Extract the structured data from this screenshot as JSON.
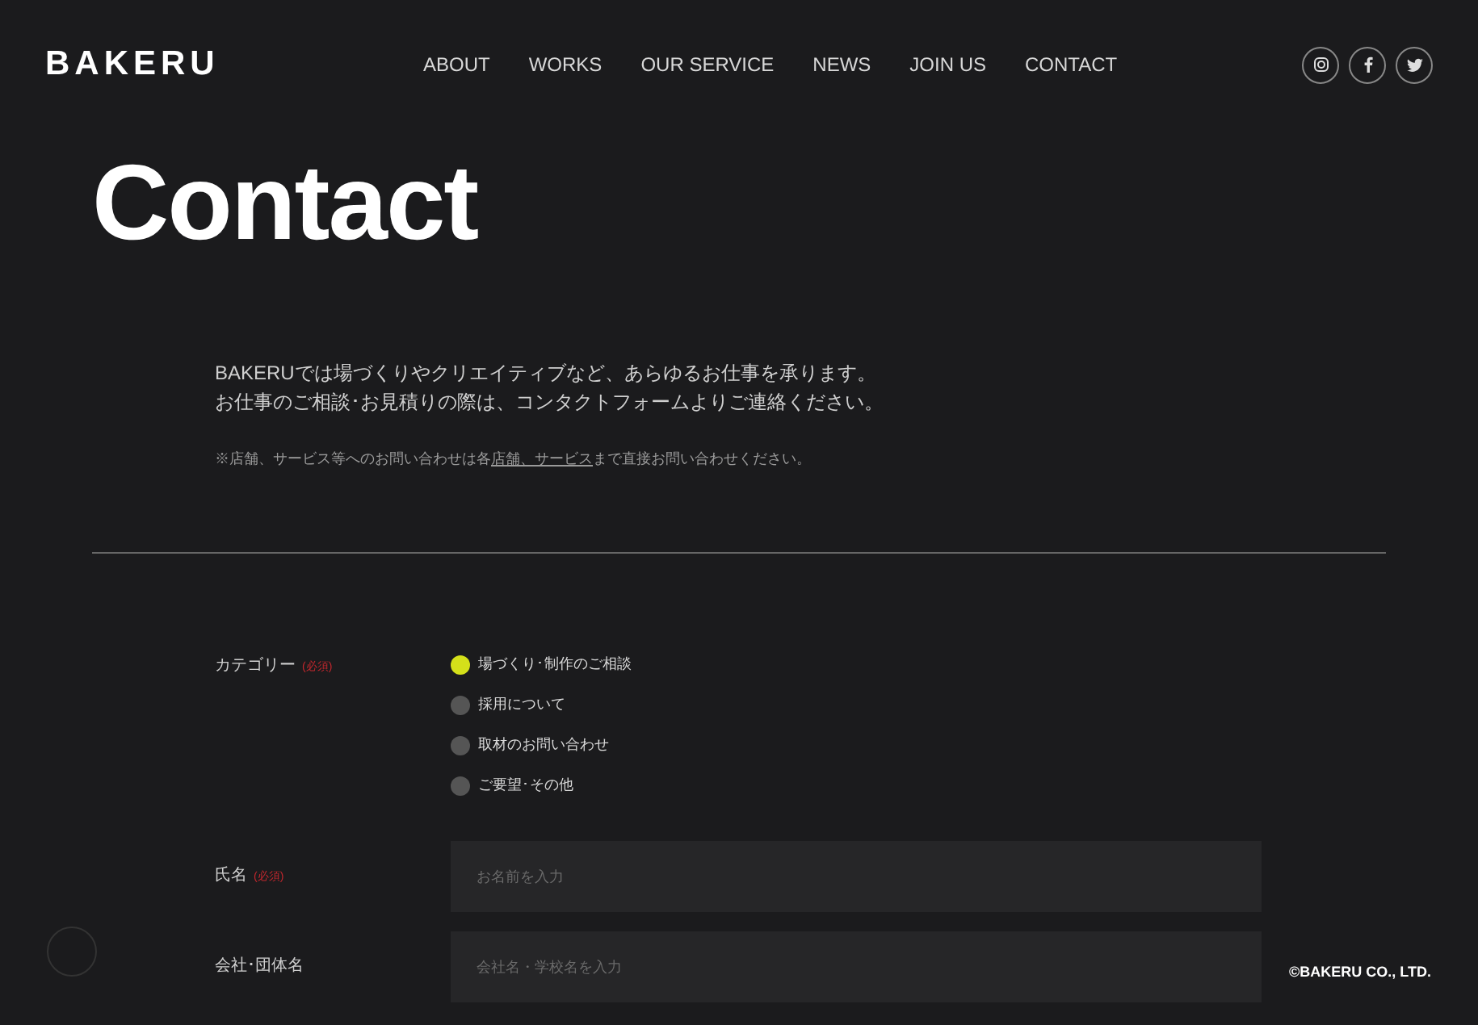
{
  "logo": "BAKERU",
  "nav": [
    "ABOUT",
    "WORKS",
    "OUR SERVICE",
    "NEWS",
    "JOIN US",
    "CONTACT"
  ],
  "social": [
    {
      "kind": "instagram"
    },
    {
      "kind": "facebook"
    },
    {
      "kind": "twitter"
    }
  ],
  "title": "Contact",
  "intro": [
    "BAKERUでは場づくりやクリエイティブなど、あらゆるお仕事を承ります。",
    "お仕事のご相談･お見積りの際は、コンタクトフォームよりご連絡ください。"
  ],
  "note": {
    "before": "※店舗、サービス等へのお問い合わせは各",
    "link": "店舗、サービス",
    "after": "まで直接お問い合わせください。"
  },
  "category": {
    "label": "カテゴリー",
    "required": "(必須)",
    "options": [
      {
        "label": "場づくり･制作のご相談",
        "selected": true
      },
      {
        "label": "採用について",
        "selected": false
      },
      {
        "label": "取材のお問い合わせ",
        "selected": false
      },
      {
        "label": "ご要望･その他",
        "selected": false
      }
    ]
  },
  "fields": [
    {
      "label": "氏名",
      "required": "(必須)",
      "placeholder": "お名前を入力"
    },
    {
      "label": "会社･団体名",
      "placeholder": "会社名・学校名を入力"
    }
  ],
  "copyright": "©BAKERU CO., LTD."
}
